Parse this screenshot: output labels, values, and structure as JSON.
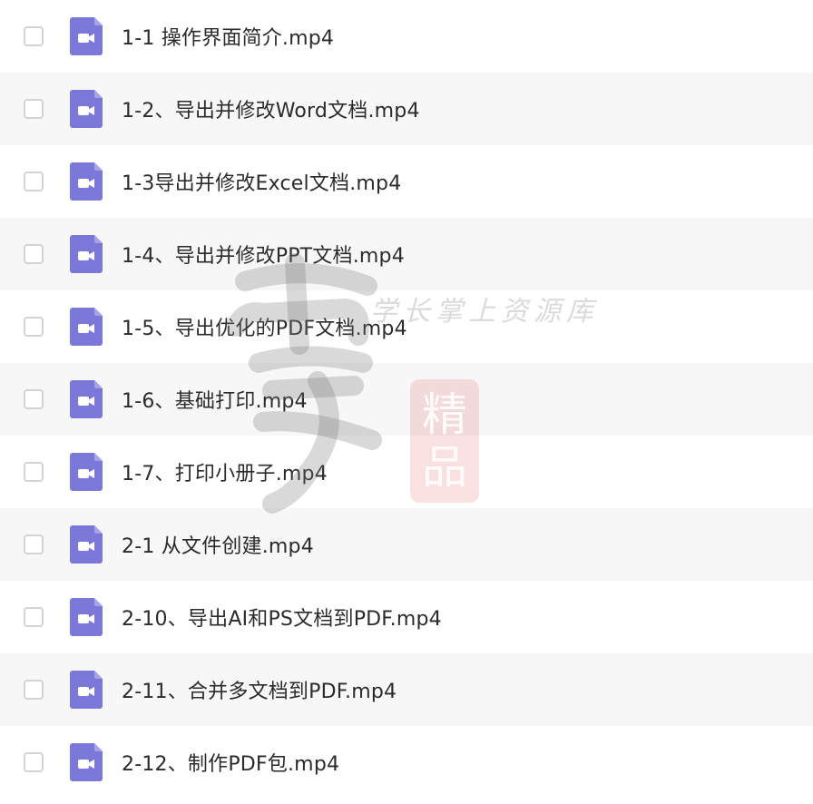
{
  "files": [
    {
      "name": "1-1 操作界面简介.mp4"
    },
    {
      "name": "1-2、导出并修改Word文档.mp4"
    },
    {
      "name": "1-3导出并修改Excel文档.mp4"
    },
    {
      "name": "1-4、导出并修改PPT文档.mp4"
    },
    {
      "name": "1-5、导出优化的PDF文档.mp4"
    },
    {
      "name": "1-6、基础打印.mp4"
    },
    {
      "name": "1-7、打印小册子.mp4"
    },
    {
      "name": "2-1 从文件创建.mp4"
    },
    {
      "name": "2-10、导出AI和PS文档到PDF.mp4"
    },
    {
      "name": "2-11、合并多文档到PDF.mp4"
    },
    {
      "name": "2-12、制作PDF包.mp4"
    }
  ],
  "icons": {
    "file_type": "video-file-icon",
    "checkbox": "checkbox"
  },
  "colors": {
    "icon_bg": "#7b78d9",
    "row_alt": "#f7f7f7",
    "text": "#2b2b2b"
  },
  "watermark": {
    "text": "学长掌上资源库",
    "seal_line1": "精",
    "seal_line2": "品"
  }
}
